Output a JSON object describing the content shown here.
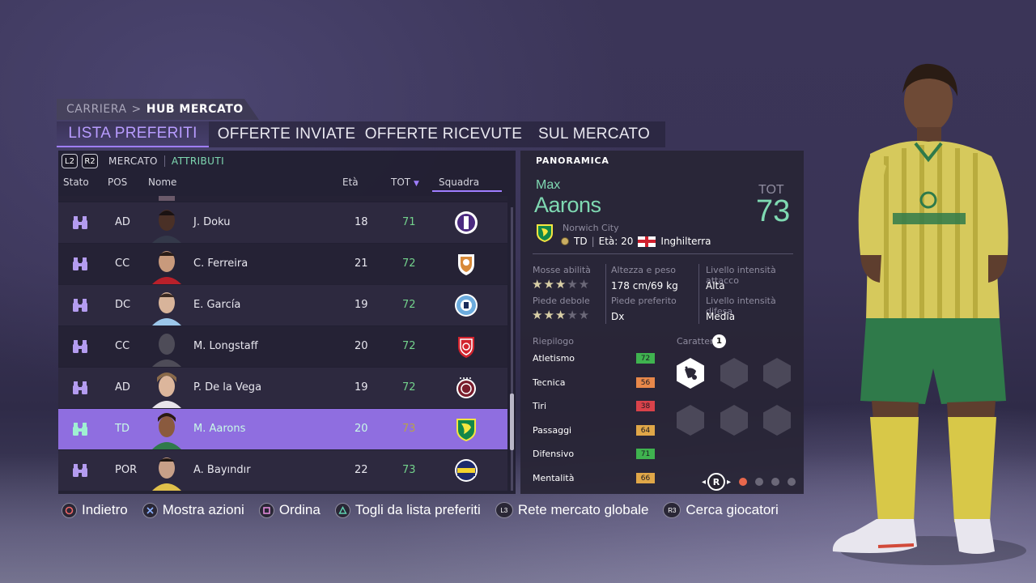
{
  "breadcrumb": {
    "parent": "CARRIERA",
    "separator": ">",
    "current": "HUB MERCATO"
  },
  "tabs": [
    {
      "label": "LISTA PREFERITI"
    },
    {
      "label": "OFFERTE INVIATE"
    },
    {
      "label": "OFFERTE RICEVUTE"
    },
    {
      "label": "SUL MERCATO"
    }
  ],
  "active_tab_index": 0,
  "subheader": {
    "l2": "L2",
    "r2": "R2",
    "mercato": "MERCATO",
    "attributi": "ATTRIBUTI"
  },
  "columns": {
    "stato": "Stato",
    "pos": "POS",
    "nome": "Nome",
    "eta": "Età",
    "tot": "TOT",
    "squadra": "Squadra"
  },
  "players": [
    {
      "pos": "AD",
      "name": "J. Doku",
      "age": "18",
      "ovr": "71",
      "crest": "anderlecht"
    },
    {
      "pos": "CC",
      "name": "C. Ferreira",
      "age": "21",
      "ovr": "72",
      "crest": "shield-red-white"
    },
    {
      "pos": "DC",
      "name": "E. García",
      "age": "19",
      "ovr": "72",
      "crest": "man-city"
    },
    {
      "pos": "CC",
      "name": "M. Longstaff",
      "age": "20",
      "ovr": "72",
      "crest": "brest"
    },
    {
      "pos": "AD",
      "name": "P. De la Vega",
      "age": "19",
      "ovr": "72",
      "crest": "lanus"
    },
    {
      "pos": "TD",
      "name": "M. Aarons",
      "age": "20",
      "ovr": "73",
      "crest": "norwich"
    },
    {
      "pos": "POR",
      "name": "A. Bayındır",
      "age": "22",
      "ovr": "73",
      "crest": "fenerbahce"
    }
  ],
  "selected_row_index": 5,
  "detail": {
    "section": "PANORAMICA",
    "first_name": "Max",
    "last_name": "Aarons",
    "tot_label": "TOT",
    "tot_value": "73",
    "club": "Norwich City",
    "position": "TD",
    "age_text": "Età: 20",
    "nation": "Inghilterra",
    "skill_moves_label": "Mosse abilità",
    "skill_moves_stars": 3,
    "weak_foot_label": "Piede debole",
    "weak_foot_stars": 3,
    "height_weight_label": "Altezza e peso",
    "height_weight": "178 cm/69 kg",
    "pref_foot_label": "Piede preferito",
    "pref_foot": "Dx",
    "att_work_label": "Livello intensità attacco",
    "att_work": "Alta",
    "def_work_label": "Livello intensità difesa",
    "def_work": "Media",
    "summary_label": "Riepilogo",
    "traits_label": "Caratter.",
    "traits_count": "1",
    "stats": [
      {
        "name": "Atletismo",
        "value": "72",
        "color": "#3fb34f"
      },
      {
        "name": "Tecnica",
        "value": "56",
        "color": "#e8884a"
      },
      {
        "name": "Tiri",
        "value": "38",
        "color": "#d9424a"
      },
      {
        "name": "Passaggi",
        "value": "64",
        "color": "#e0a748"
      },
      {
        "name": "Difensivo",
        "value": "71",
        "color": "#3fb34f"
      },
      {
        "name": "Mentalità",
        "value": "66",
        "color": "#e0a748"
      }
    ],
    "page_button": "R",
    "pages_total": 4,
    "page_active": 0
  },
  "hints": [
    {
      "button": "circle",
      "label": "Indietro"
    },
    {
      "button": "cross",
      "label": "Mostra azioni"
    },
    {
      "button": "square",
      "label": "Ordina"
    },
    {
      "button": "triangle",
      "label": "Togli da lista preferiti"
    },
    {
      "button": "L3",
      "label": "Rete mercato globale"
    },
    {
      "button": "R3",
      "label": "Cerca giocatori"
    }
  ],
  "colors": {
    "accent": "#9f7eff",
    "green": "#7fd9b2",
    "selected_row": "#8f6ee0"
  }
}
